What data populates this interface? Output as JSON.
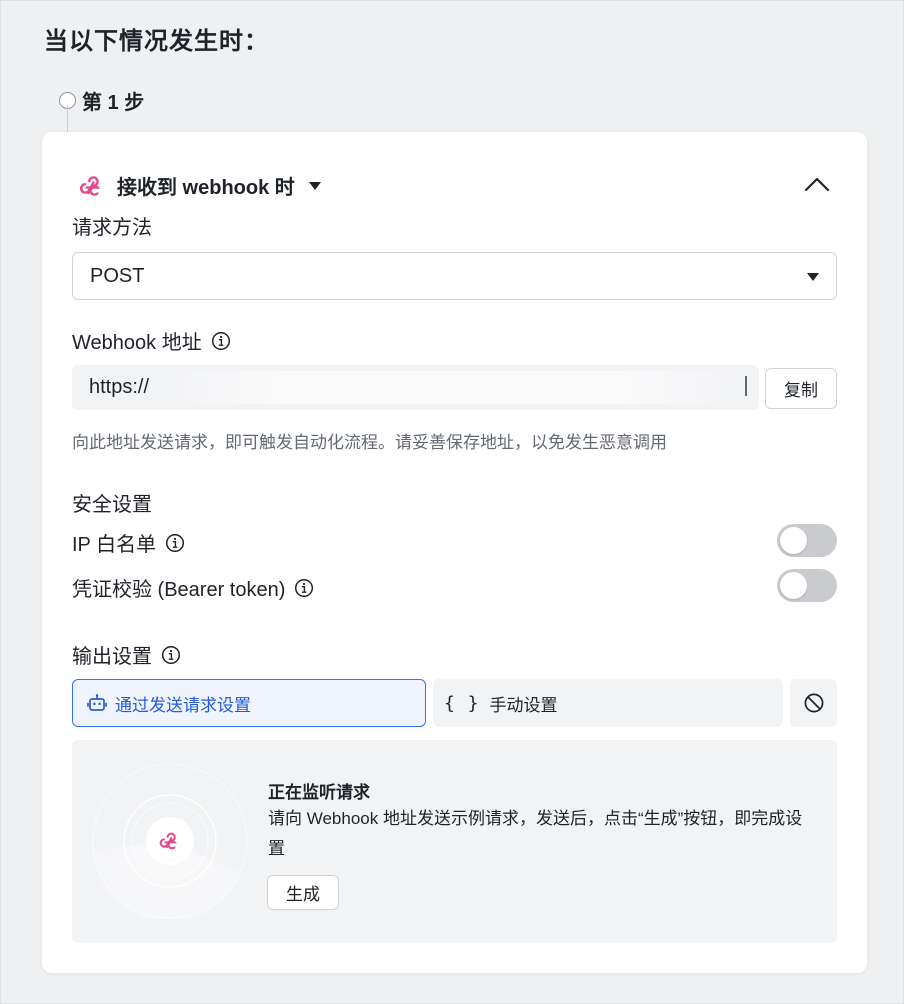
{
  "page": {
    "heading": "当以下情况发生时："
  },
  "step": {
    "label": "第 1 步"
  },
  "trigger": {
    "title": "接收到 webhook 时",
    "icon": "webhook-icon",
    "accent": "#e8468a"
  },
  "request_method": {
    "label": "请求方法",
    "value": "POST"
  },
  "webhook_url": {
    "label": "Webhook 地址",
    "value": "https://",
    "copy_label": "复制",
    "hint": "向此地址发送请求，即可触发自动化流程。请妥善保存地址，以免发生恶意调用"
  },
  "security": {
    "label": "安全设置",
    "ip_whitelist": {
      "label": "IP 白名单",
      "enabled": false
    },
    "bearer_token": {
      "label": "凭证校验 (Bearer token)",
      "enabled": false
    }
  },
  "output": {
    "label": "输出设置",
    "modes": {
      "auto": {
        "label": "通过发送请求设置",
        "icon": "robot-icon",
        "selected": true
      },
      "manual": {
        "label": "手动设置",
        "icon": "{ }"
      },
      "none": {
        "icon": "ban-icon"
      }
    },
    "listening": {
      "title": "正在监听请求",
      "description": "请向 Webhook 地址发送示例请求，发送后，点击“生成”按钮，即完成设置",
      "generate_label": "生成"
    }
  },
  "colors": {
    "primary": "#3370ff",
    "primary_bg": "#f0f4ff",
    "panel_bg": "#f2f3f5",
    "toggle_off": "#c9cbcf"
  }
}
